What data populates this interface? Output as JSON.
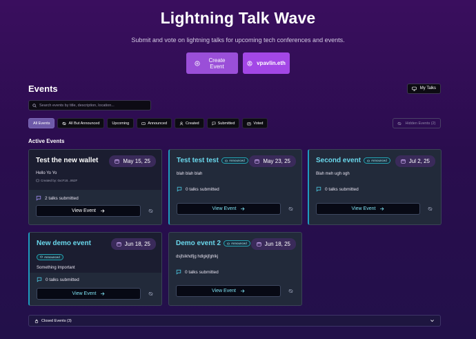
{
  "hero": {
    "title": "Lightning Talk Wave",
    "subtitle": "Submit and vote on lightning talks for upcoming tech conferences and events.",
    "create_label": "Create Event",
    "wallet_label": "vpavlin.eth"
  },
  "events": {
    "heading": "Events",
    "my_talks_label": "My Talks",
    "search_placeholder": "Search events by title, description, location...",
    "filters": [
      "All Events",
      "All But Announced",
      "Upcoming",
      "Announced",
      "Created",
      "Submitted",
      "Voted"
    ],
    "hidden_label": "Hidden Events (2)",
    "active_heading": "Active Events"
  },
  "cards": [
    {
      "title": "Test the new wallet",
      "date": "May 15, 25",
      "desc": "Hello Yo Yo",
      "creator": "Created by: 0xcF18...862F",
      "talks": "2 talks submitted",
      "view": "View Event"
    },
    {
      "title": "Test test test",
      "badge": "Announced",
      "date": "May 23, 25",
      "desc": "blah blah blah",
      "talks": "0 talks submitted",
      "view": "View Event"
    },
    {
      "title": "Second event",
      "badge": "Announced",
      "date": "Jul 2, 25",
      "desc": "Blah meh ugh ogh",
      "talks": "0 talks submitted",
      "view": "View Event"
    },
    {
      "title": "New demo event",
      "badge": "Announced",
      "date": "Jun 18, 25",
      "desc": "Something Important",
      "talks": "0 talks submitted",
      "view": "View Event"
    },
    {
      "title": "Demo event 2",
      "badge": "Announced",
      "date": "Jun 18, 25",
      "desc": "dsjfslkhdfjg hdlgkjfghlkj",
      "talks": "0 talks submitted",
      "view": "View Event"
    }
  ],
  "closed": {
    "label": "Closed Events (3)"
  },
  "colors": {
    "accent": "#6ad8ec",
    "primary": "#9a4fd8",
    "card": "#222a3a"
  }
}
